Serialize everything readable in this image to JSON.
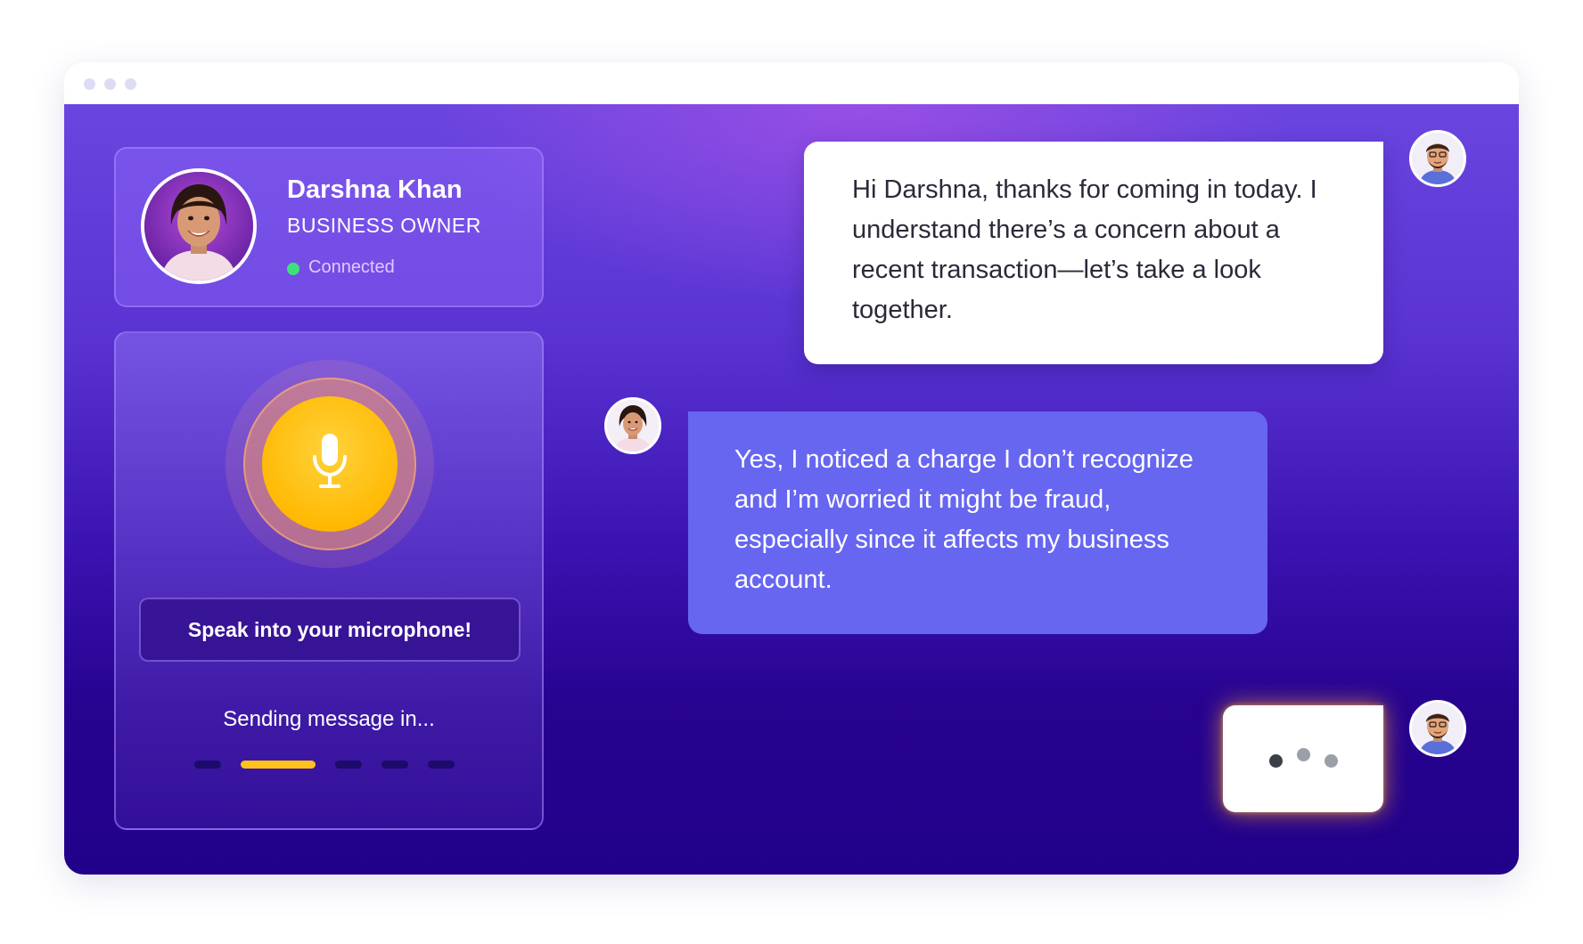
{
  "profile": {
    "name": "Darshna Khan",
    "role": "BUSINESS OWNER",
    "status": "Connected",
    "status_color": "#3fe07a"
  },
  "voice_panel": {
    "prompt": "Speak into your microphone!",
    "sending_label": "Sending message in...",
    "countdown": {
      "total_segments": 5,
      "active_segment": 2
    },
    "mic_color": "#ffc21a"
  },
  "messages": [
    {
      "sender": "agent",
      "text": "Hi Darshna, thanks for coming in today. I understand there’s a concern about a recent transaction—let’s take a look together."
    },
    {
      "sender": "user",
      "text": "Yes, I noticed a charge I don’t recognize and I’m worried it might be fraud, especially since it affects my business account."
    }
  ],
  "typing_indicator": {
    "sender": "agent"
  },
  "colors": {
    "background_top": "#6a45df",
    "background_bottom": "#22018a",
    "user_bubble": "#6766f1",
    "agent_bubble": "#ffffff",
    "accent": "#ffc21a"
  },
  "icons": {
    "mic": "microphone-icon",
    "window_controls": "window-dots-icon"
  }
}
